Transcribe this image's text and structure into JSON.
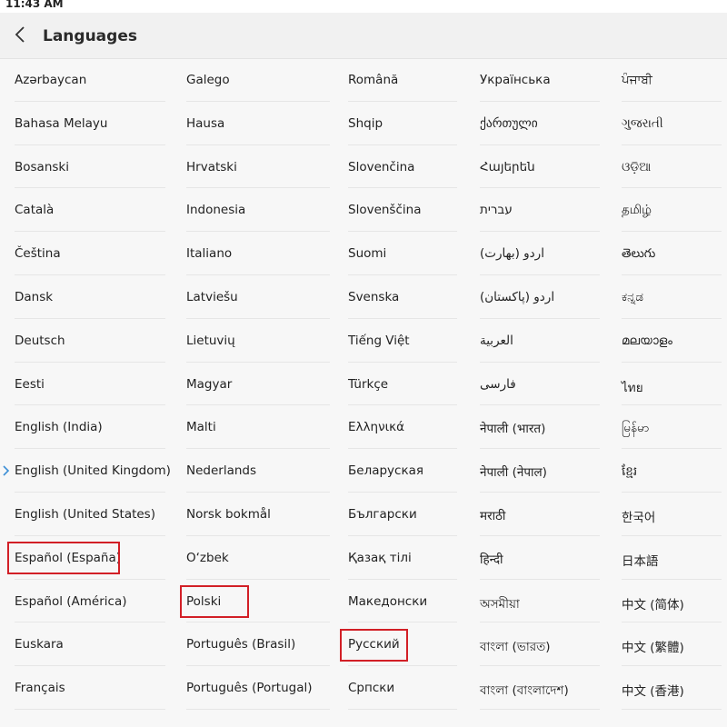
{
  "status_bar": {
    "time": "11:43 AM"
  },
  "header": {
    "title": "Languages",
    "back_icon": "chevron-left-icon"
  },
  "selected_language": "English (United Kingdom)",
  "highlight_color": "#d21f26",
  "columns": [
    [
      "Azərbaycan",
      "Bahasa Melayu",
      "Bosanski",
      "Català",
      "Čeština",
      "Dansk",
      "Deutsch",
      "Eesti",
      "English (India)",
      "English (United Kingdom)",
      "English (United States)",
      "Español (España)",
      "Español (América)",
      "Euskara",
      "Français"
    ],
    [
      "Galego",
      "Hausa",
      "Hrvatski",
      "Indonesia",
      "Italiano",
      "Latviešu",
      "Lietuvių",
      "Magyar",
      "Malti",
      "Nederlands",
      "Norsk bokmål",
      "O‘zbek",
      "Polski",
      "Português (Brasil)",
      "Português (Portugal)"
    ],
    [
      "Română",
      "Shqip",
      "Slovenčina",
      "Slovenščina",
      "Suomi",
      "Svenska",
      "Tiếng Việt",
      "Türkçe",
      "Ελληνικά",
      "Беларуская",
      "Български",
      "Қазақ тілі",
      "Македонски",
      "Русский",
      "Српски"
    ],
    [
      "Українська",
      "ქართული",
      "Հայերեն",
      "עברית",
      "اردو (بھارت)",
      "اردو (پاکستان)",
      "العربية",
      "فارسی",
      "नेपाली (भारत)",
      "नेपाली (नेपाल)",
      "मराठी",
      "हिन्दी",
      "অসমীয়া",
      "বাংলা (ভারত)",
      "বাংলা (বাংলাদেশ)"
    ],
    [
      "ਪੰਜਾਬੀ",
      "ગુજરાતી",
      "ଓଡ଼ିଆ",
      "தமிழ்",
      "తెలుగు",
      "ಕನ್ನಡ",
      "മലയാളം",
      "ไทย",
      "မြန်မာ",
      "ខ្មែរ",
      "한국어",
      "日本語",
      "中文 (简体)",
      "中文 (繁體)",
      "中文 (香港)"
    ]
  ]
}
